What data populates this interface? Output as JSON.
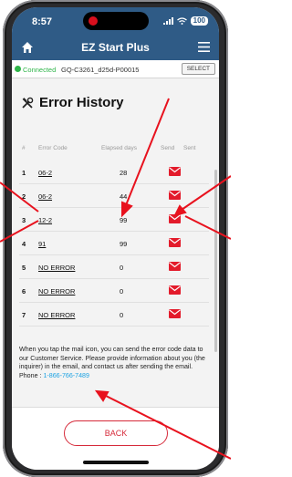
{
  "status_bar": {
    "time": "8:57",
    "battery": "100"
  },
  "app": {
    "title": "EZ Start Plus"
  },
  "connection": {
    "status": "Connected",
    "device": "GQ-C3261_d25d-P00015",
    "select_label": "SELECT"
  },
  "page": {
    "title": "Error History"
  },
  "table": {
    "headers": {
      "index": "#",
      "code": "Error Code",
      "days": "Elapsed days",
      "send": "Send",
      "sent": "Sent"
    },
    "rows": [
      {
        "index": "1",
        "code": "06-2",
        "days": "28"
      },
      {
        "index": "2",
        "code": "06-2",
        "days": "44"
      },
      {
        "index": "3",
        "code": "12-2",
        "days": "99"
      },
      {
        "index": "4",
        "code": "91",
        "days": "99"
      },
      {
        "index": "5",
        "code": "NO ERROR",
        "days": "0"
      },
      {
        "index": "6",
        "code": "NO ERROR",
        "days": "0"
      },
      {
        "index": "7",
        "code": "NO ERROR",
        "days": "0"
      }
    ]
  },
  "info": {
    "text": "When you tap the mail icon, you can send the error code data to our Customer Service. Please provide information about you (the inquirer) in the email, and contact us after sending the email.",
    "phone_label": "Phone : ",
    "phone_number": "1-866-766-7489"
  },
  "back_label": "BACK",
  "colors": {
    "header": "#2f5b86",
    "accent_red": "#d62a3a",
    "connected_green": "#2fb54a",
    "link_blue": "#1ba1e2",
    "annotation_red": "#e8121e"
  }
}
